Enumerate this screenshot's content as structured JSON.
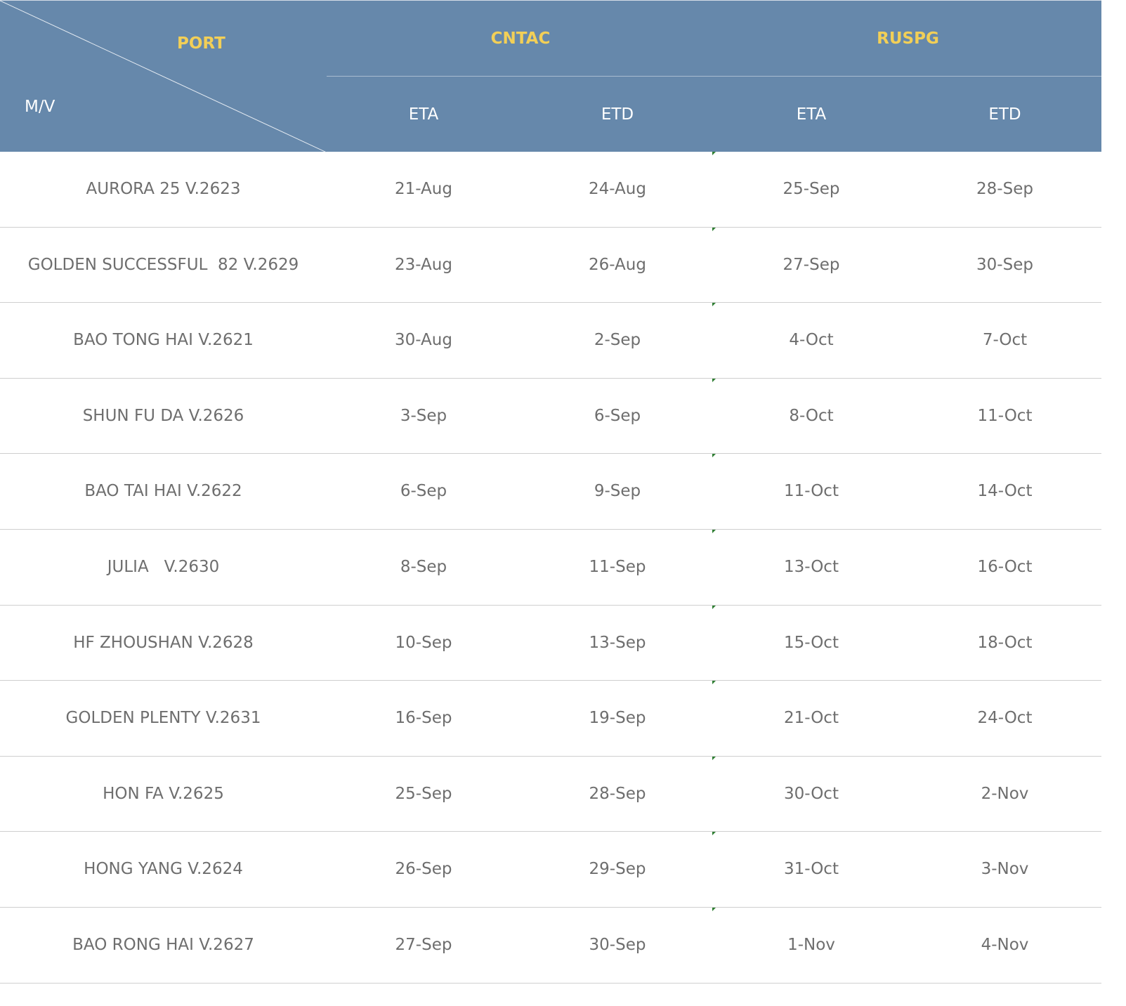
{
  "header": {
    "port_label": "PORT",
    "mv_label": "M/V",
    "groups": [
      "CNTAC",
      "RUSPG"
    ],
    "subcolumns": [
      "ETA",
      "ETD",
      "ETA",
      "ETD"
    ]
  },
  "colors": {
    "header_bg": "#6688ab",
    "group_text": "#f2cf57",
    "header_text": "#ffffff",
    "body_text": "#6e6e6e",
    "row_border": "#cfcfcf"
  },
  "rows": [
    {
      "vessel": "AURORA 25 V.2623",
      "cntac_eta": "21-Aug",
      "cntac_etd": "24-Aug",
      "ruspg_eta": "25-Sep",
      "ruspg_etd": "28-Sep"
    },
    {
      "vessel": "GOLDEN SUCCESSFUL  82 V.2629",
      "cntac_eta": "23-Aug",
      "cntac_etd": "26-Aug",
      "ruspg_eta": "27-Sep",
      "ruspg_etd": "30-Sep"
    },
    {
      "vessel": "BAO TONG HAI V.2621",
      "cntac_eta": "30-Aug",
      "cntac_etd": "2-Sep",
      "ruspg_eta": "4-Oct",
      "ruspg_etd": "7-Oct"
    },
    {
      "vessel": "SHUN FU DA V.2626",
      "cntac_eta": "3-Sep",
      "cntac_etd": "6-Sep",
      "ruspg_eta": "8-Oct",
      "ruspg_etd": "11-Oct"
    },
    {
      "vessel": "BAO TAI HAI V.2622",
      "cntac_eta": "6-Sep",
      "cntac_etd": "9-Sep",
      "ruspg_eta": "11-Oct",
      "ruspg_etd": "14-Oct"
    },
    {
      "vessel": "JULIA   V.2630",
      "cntac_eta": "8-Sep",
      "cntac_etd": "11-Sep",
      "ruspg_eta": "13-Oct",
      "ruspg_etd": "16-Oct"
    },
    {
      "vessel": "HF ZHOUSHAN V.2628",
      "cntac_eta": "10-Sep",
      "cntac_etd": "13-Sep",
      "ruspg_eta": "15-Oct",
      "ruspg_etd": "18-Oct"
    },
    {
      "vessel": "GOLDEN PLENTY V.2631",
      "cntac_eta": "16-Sep",
      "cntac_etd": "19-Sep",
      "ruspg_eta": "21-Oct",
      "ruspg_etd": "24-Oct"
    },
    {
      "vessel": "HON FA V.2625",
      "cntac_eta": "25-Sep",
      "cntac_etd": "28-Sep",
      "ruspg_eta": "30-Oct",
      "ruspg_etd": "2-Nov"
    },
    {
      "vessel": "HONG YANG V.2624",
      "cntac_eta": "26-Sep",
      "cntac_etd": "29-Sep",
      "ruspg_eta": "31-Oct",
      "ruspg_etd": "3-Nov"
    },
    {
      "vessel": "BAO RONG HAI V.2627",
      "cntac_eta": "27-Sep",
      "cntac_etd": "30-Sep",
      "ruspg_eta": "1-Nov",
      "ruspg_etd": "4-Nov"
    }
  ]
}
